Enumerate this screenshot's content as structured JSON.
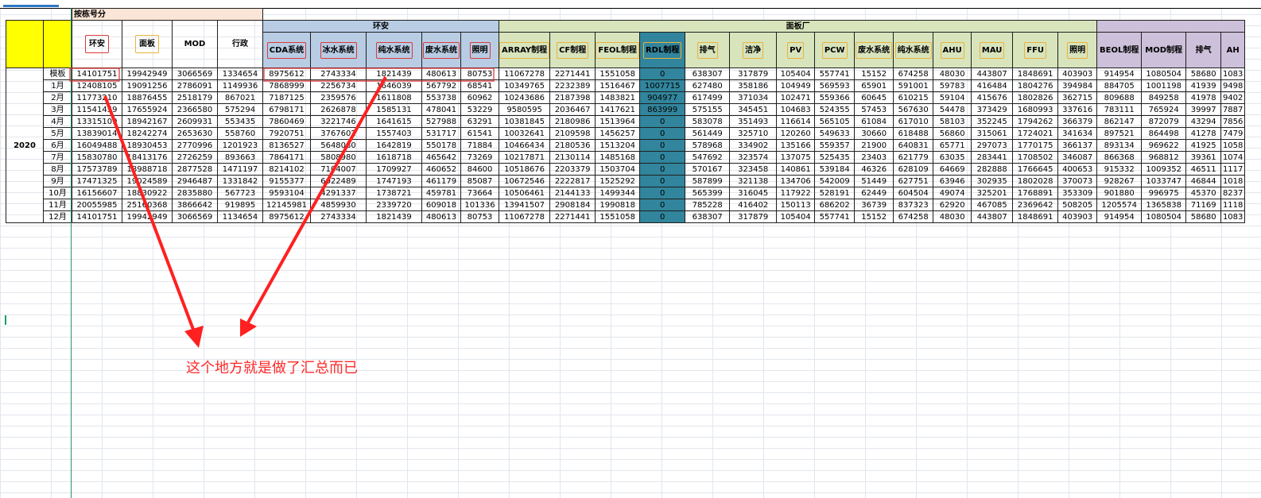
{
  "sheet": {
    "title_band": "按栋号分",
    "group_huanan": "环安",
    "group_mianban": "面板厂",
    "year": "2020",
    "annotation": "这个地方就是做了汇总而已",
    "colors": {
      "yellow": "#ffff00",
      "peach": "#fbe5d6",
      "blue": "#b8cce4",
      "green": "#d8e4bc",
      "purple": "#ccc0da",
      "teal": "#31859c",
      "red_markup": "#d83b3b"
    }
  },
  "headers": [
    "环安",
    "面板",
    "MOD",
    "行政",
    "CDA系统",
    "冰水系统",
    "纯水系统",
    "废水系统",
    "照明",
    "ARRAY制程",
    "CF制程",
    "FEOL制程",
    "RDL制程",
    "排气",
    "洁净",
    "PV",
    "PCW",
    "废水系统",
    "纯水系统",
    "AHU",
    "MAU",
    "FFU",
    "照明",
    "BEOL制程",
    "MOD制程",
    "排气",
    "AH"
  ],
  "rows": [
    [
      "模板",
      "14101751",
      "19942949",
      "3066569",
      "1334654",
      "8975612",
      "2743334",
      "1821439",
      "480613",
      "80753",
      "11067278",
      "2271441",
      "1551058",
      "0",
      "638307",
      "317879",
      "105404",
      "557741",
      "15152",
      "674258",
      "48030",
      "443807",
      "1848691",
      "403903",
      "914954",
      "1080504",
      "58680",
      "1083"
    ],
    [
      "1月",
      "12408105",
      "19091256",
      "2786091",
      "1149936",
      "7868999",
      "2256734",
      "1646039",
      "567792",
      "68541",
      "10349765",
      "2232389",
      "1516467",
      "1007715",
      "627480",
      "358186",
      "104949",
      "569593",
      "65901",
      "591001",
      "59783",
      "416484",
      "1804276",
      "394984",
      "884705",
      "1001198",
      "41939",
      "9498"
    ],
    [
      "2月",
      "11773210",
      "18876455",
      "2518179",
      "867021",
      "7187125",
      "2359576",
      "1611808",
      "553738",
      "60962",
      "10243686",
      "2187398",
      "1483821",
      "904977",
      "617499",
      "371034",
      "102471",
      "559366",
      "60645",
      "610215",
      "59104",
      "415676",
      "1802826",
      "362715",
      "809688",
      "849258",
      "41978",
      "9402"
    ],
    [
      "3月",
      "11541459",
      "17655924",
      "2366580",
      "575294",
      "6798171",
      "2626878",
      "1585131",
      "478041",
      "53229",
      "9580595",
      "2036467",
      "1417621",
      "863999",
      "575155",
      "345451",
      "104683",
      "524355",
      "57453",
      "567630",
      "54478",
      "373429",
      "1680993",
      "337616",
      "783111",
      "765924",
      "39997",
      "7887"
    ],
    [
      "4月",
      "13315109",
      "18942167",
      "2609931",
      "553435",
      "7860469",
      "3221746",
      "1641615",
      "527988",
      "63291",
      "10381845",
      "2180986",
      "1513964",
      "0",
      "583078",
      "351493",
      "116614",
      "565105",
      "61084",
      "617010",
      "58103",
      "352245",
      "1794262",
      "366379",
      "862147",
      "872079",
      "43294",
      "7856"
    ],
    [
      "5月",
      "13839014",
      "18242274",
      "2653630",
      "558760",
      "7920751",
      "3767602",
      "1557403",
      "531717",
      "61541",
      "10032641",
      "2109598",
      "1456257",
      "0",
      "561449",
      "325710",
      "120260",
      "549633",
      "30660",
      "618488",
      "56860",
      "315061",
      "1724021",
      "341634",
      "897521",
      "864498",
      "41278",
      "7479"
    ],
    [
      "6月",
      "16049488",
      "18930453",
      "2770996",
      "1201923",
      "8136527",
      "5648080",
      "1642819",
      "550178",
      "71884",
      "10466434",
      "2180536",
      "1513204",
      "0",
      "578968",
      "334902",
      "135166",
      "559357",
      "21900",
      "640831",
      "65771",
      "297073",
      "1770175",
      "366137",
      "893134",
      "969622",
      "41925",
      "1058"
    ],
    [
      "7月",
      "15830780",
      "18413176",
      "2726259",
      "893663",
      "7864171",
      "5808980",
      "1618718",
      "465642",
      "73269",
      "10217871",
      "2130114",
      "1485168",
      "0",
      "547692",
      "323574",
      "137075",
      "525435",
      "23403",
      "621779",
      "63035",
      "283441",
      "1708502",
      "346087",
      "866368",
      "968812",
      "39361",
      "1074"
    ],
    [
      "8月",
      "17573789",
      "18988718",
      "2877528",
      "1471197",
      "8214102",
      "7104007",
      "1709927",
      "460652",
      "84600",
      "10518676",
      "2203379",
      "1503704",
      "0",
      "570167",
      "323458",
      "140861",
      "539184",
      "46326",
      "628109",
      "64669",
      "282888",
      "1766645",
      "400653",
      "915332",
      "1009352",
      "46511",
      "1117"
    ],
    [
      "9月",
      "17471325",
      "19024589",
      "2946487",
      "1331842",
      "9155377",
      "6022489",
      "1747193",
      "461179",
      "85087",
      "10672546",
      "2222817",
      "1525292",
      "0",
      "587899",
      "321138",
      "134706",
      "542009",
      "51449",
      "627751",
      "63946",
      "302935",
      "1802028",
      "370073",
      "928267",
      "1033747",
      "46844",
      "1018"
    ],
    [
      "10月",
      "16156607",
      "18830922",
      "2835880",
      "567723",
      "9593104",
      "4291337",
      "1738721",
      "459781",
      "73664",
      "10506461",
      "2144133",
      "1499344",
      "0",
      "565399",
      "316045",
      "117922",
      "528191",
      "62449",
      "604504",
      "49074",
      "325201",
      "1768891",
      "353309",
      "901880",
      "996975",
      "45370",
      "8237"
    ],
    [
      "11月",
      "20055985",
      "25160368",
      "3866642",
      "919895",
      "12145981",
      "4859930",
      "2339720",
      "609018",
      "101336",
      "13941507",
      "2908184",
      "1990818",
      "0",
      "785228",
      "416402",
      "150113",
      "686202",
      "36739",
      "837323",
      "62920",
      "467085",
      "2369642",
      "508205",
      "1205574",
      "1365838",
      "71169",
      "1118"
    ],
    [
      "12月",
      "14101751",
      "19942949",
      "3066569",
      "1134654",
      "8975612",
      "2743334",
      "1821439",
      "480613",
      "80753",
      "11067278",
      "2271441",
      "1551058",
      "0",
      "638307",
      "317879",
      "105404",
      "557741",
      "15152",
      "674258",
      "48030",
      "443807",
      "1848691",
      "403903",
      "914954",
      "1080504",
      "58680",
      "1083"
    ]
  ]
}
